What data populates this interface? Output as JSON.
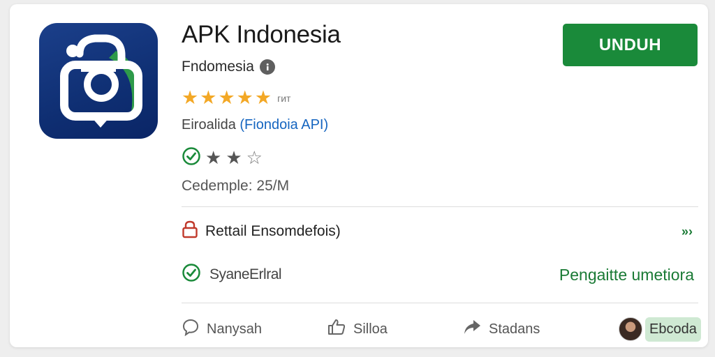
{
  "app": {
    "title": "APK Indonesia",
    "developer": "Fndomesia",
    "rating_suffix": "ᴦᴎᴛ",
    "category_prefix": "Eiroalida",
    "category_link": "(Fiondoia API)",
    "size_text": "Cedemple: 25/M"
  },
  "actions": {
    "download_label": "UNDUH"
  },
  "rows": {
    "permission_label": "Rettail Ensomdefois)",
    "permission_chevron": "»›",
    "safety_label": "SyaneErlral",
    "safety_link": "Pengaitte umetiora"
  },
  "action_bar": {
    "item1": "Nanysah",
    "item2": "Silloa",
    "item3": "Stadans",
    "item4": "Ebcoda"
  },
  "colors": {
    "primary_green": "#1a8a3a",
    "star_gold": "#f3a826",
    "icon_blue": "#0f2f73",
    "link_blue": "#1565c0"
  },
  "icons": [
    "info-icon",
    "check-circle-icon",
    "lock-icon",
    "chevron-right-icon",
    "speech-bubble-icon",
    "thumbs-up-icon",
    "share-arrow-icon",
    "avatar"
  ]
}
